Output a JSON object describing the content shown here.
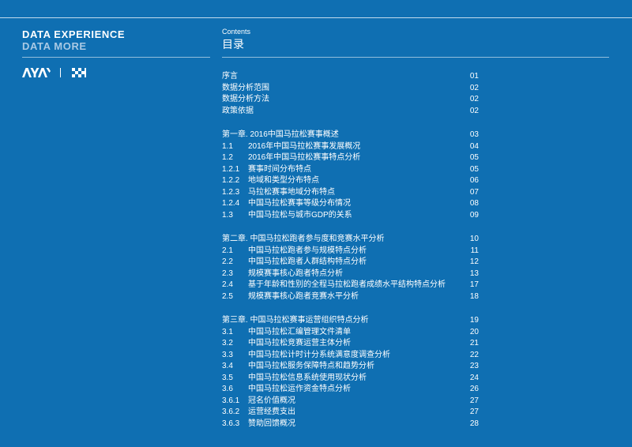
{
  "brand": {
    "line1": "DATA EXPERIENCE",
    "line2": "DATA MORE"
  },
  "logos": [
    {
      "name": "AYAY"
    },
    {
      "name": "checkered-flag"
    }
  ],
  "contents": {
    "en": "Contents",
    "zh": "目录"
  },
  "toc": [
    {
      "group": "intro",
      "rows": [
        {
          "num": "",
          "title": "序言",
          "page": "01"
        },
        {
          "num": "",
          "title": "数据分析范围",
          "page": "02"
        },
        {
          "num": "",
          "title": "数据分析方法",
          "page": "02"
        },
        {
          "num": "",
          "title": "政策依据",
          "page": "02"
        }
      ]
    },
    {
      "group": "chapter-1",
      "rows": [
        {
          "num": "",
          "title": "第一章. 2016中国马拉松赛事概述",
          "page": "03"
        },
        {
          "num": "1.1",
          "title": "2016年中国马拉松赛事发展概况",
          "page": "04"
        },
        {
          "num": "1.2",
          "title": "2016年中国马拉松赛事特点分析",
          "page": "05"
        },
        {
          "num": "1.2.1",
          "title": "赛事时间分布特点",
          "page": "05"
        },
        {
          "num": "1.2.2",
          "title": "地域和类型分布特点",
          "page": "06"
        },
        {
          "num": "1.2.3",
          "title": "马拉松赛事地域分布特点",
          "page": "07"
        },
        {
          "num": "1.2.4",
          "title": "中国马拉松赛事等级分布情况",
          "page": "08"
        },
        {
          "num": "1.3",
          "title": "中国马拉松与城市GDP的关系",
          "page": "09"
        }
      ]
    },
    {
      "group": "chapter-2",
      "rows": [
        {
          "num": "",
          "title": "第二章. 中国马拉松跑者参与度和竞赛水平分析",
          "page": "10"
        },
        {
          "num": "2.1",
          "title": "中国马拉松跑者参与规模特点分析",
          "page": "11"
        },
        {
          "num": "2.2",
          "title": "中国马拉松跑者人群结构特点分析",
          "page": "12"
        },
        {
          "num": "2.3",
          "title": "规模赛事核心跑者特点分析",
          "page": "13"
        },
        {
          "num": "2.4",
          "title": "基于年龄和性别的全程马拉松跑者成绩水平结构特点分析",
          "page": "17"
        },
        {
          "num": "2.5",
          "title": "规模赛事核心跑者竞赛水平分析",
          "page": "18"
        }
      ]
    },
    {
      "group": "chapter-3",
      "rows": [
        {
          "num": "",
          "title": "第三章. 中国马拉松赛事运营组织特点分析",
          "page": "19"
        },
        {
          "num": "3.1",
          "title": "中国马拉松汇编管理文件清单",
          "page": "20"
        },
        {
          "num": "3.2",
          "title": "中国马拉松竞赛运营主体分析",
          "page": "21"
        },
        {
          "num": "3.3",
          "title": "中国马拉松计时计分系统满意度调查分析",
          "page": "22"
        },
        {
          "num": "3.4",
          "title": "中国马拉松服务保障特点和趋势分析",
          "page": "23"
        },
        {
          "num": "3.5",
          "title": "中国马拉松信息系统使用现状分析",
          "page": "24"
        },
        {
          "num": "3.6",
          "title": "中国马拉松运作资金特点分析",
          "page": "26"
        },
        {
          "num": "3.6.1",
          "title": "冠名价值概况",
          "page": "27"
        },
        {
          "num": "3.6.2",
          "title": "运营经费支出",
          "page": "27"
        },
        {
          "num": "3.6.3",
          "title": "赞助回馈概况",
          "page": "28"
        }
      ]
    }
  ]
}
